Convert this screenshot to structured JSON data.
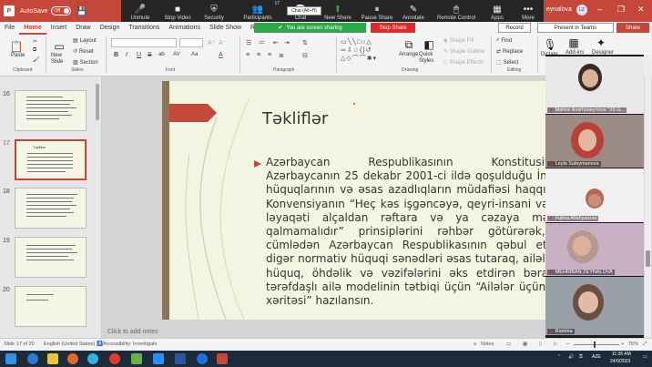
{
  "titlebar": {
    "autosave_label": "AutoSave",
    "autosave_state": "Off",
    "user_name": "eynalova",
    "user_initials": "LZ"
  },
  "zoom_toolbar": {
    "items": [
      {
        "label": "Unmute",
        "glyph": "🎤"
      },
      {
        "label": "Stop Video",
        "glyph": "■"
      },
      {
        "label": "Security",
        "glyph": "⛨"
      },
      {
        "label": "Participants",
        "glyph": "👥",
        "count": "17"
      },
      {
        "label": "Chat",
        "glyph": "💬"
      },
      {
        "label": "New Share",
        "glyph": "⬆"
      },
      {
        "label": "Pause Share",
        "glyph": "⏸"
      },
      {
        "label": "Annotate",
        "glyph": "✎"
      },
      {
        "label": "Remote Control",
        "glyph": "🖱"
      },
      {
        "label": "Apps",
        "glyph": "▦"
      },
      {
        "label": "More",
        "glyph": "•••"
      }
    ],
    "chat_tooltip": "Chat (Alt+H)"
  },
  "ribbon_tabs": [
    "File",
    "Home",
    "Insert",
    "Draw",
    "Design",
    "Transitions",
    "Animations",
    "Slide Show",
    "Record"
  ],
  "active_tab": "Home",
  "screen_sharing_banner": "You are screen sharing",
  "stop_share_label": "Stop Share",
  "record_button": "Record",
  "present_button": "Present in Teams",
  "share_button": "Share",
  "ribbon": {
    "clipboard": {
      "paste": "Paste",
      "label": "Clipboard"
    },
    "slides": {
      "new_slide": "New Slide",
      "layout": "Layout",
      "reset": "Reset",
      "section": "Section",
      "label": "Slides"
    },
    "font_label": "Font",
    "font_buttons": [
      "B",
      "I",
      "U",
      "S",
      "ab",
      "AV",
      "Aa",
      "A"
    ],
    "paragraph_label": "Paragraph",
    "drawing": {
      "arrange": "Arrange",
      "quick_styles": "Quick Styles",
      "shape_fill": "Shape Fill",
      "shape_outline": "Shape Outline",
      "shape_effects": "Shape Effects",
      "label": "Drawing"
    },
    "editing": {
      "find": "Find",
      "replace": "Replace",
      "select": "Select",
      "label": "Editing"
    },
    "voice": {
      "dictate": "Dictate",
      "label": "Voice"
    },
    "addins": {
      "addins": "Add-ins",
      "label": "Add-ins"
    },
    "designer": {
      "designer": "Designer"
    }
  },
  "thumbnails": [
    {
      "number": "16",
      "active": false
    },
    {
      "number": "17",
      "active": true,
      "title": "Təkliflər"
    },
    {
      "number": "18",
      "active": false
    },
    {
      "number": "19",
      "active": false
    },
    {
      "number": "20",
      "active": false
    }
  ],
  "slide": {
    "title": "Təkliflər",
    "body": "Azərbaycan Respublikasının Konstitusiyası Azərbaycanın 25 dekabr 2001-ci ildə qoşulduğu İnsan hüquqlarının və əsas azadlıqların müdafiəsi haqqında Konvensiyanın “Heç kəs işgəncəyə, qeyri-insani və ya ləyaqəti alçaldan rəftara və ya cəzaya məruz qalmamalıdır” prinsiplərini rəhbər götürərək, o cümlədən Azərbaycan Respublikasının qəbul etdiyi digər normativ hüquqi sənədləri əsas tutaraq, ailələrin hüquq, öhdəlik və vəzifələrini əks etdirən bərabər tərəfdaşlı ailə modelinin tətbiqi üçün “Ailələr üçün yol xəritəsi” hazılansın."
  },
  "notes_placeholder": "Click to add notes",
  "participants": [
    {
      "name": "Mahire Amirhuseynova \"XII G...",
      "muted": true
    },
    {
      "name": "Leyla Suleymanova",
      "muted": true
    },
    {
      "name": "Fatma Allahyarova",
      "muted": true
    },
    {
      "name": "MEHRIBAN ZEYNALOVA",
      "muted": true
    },
    {
      "name": "Ramina",
      "muted": true
    }
  ],
  "statusbar": {
    "slide_info": "Slide 17 of 20",
    "language": "English (United States)",
    "accessibility": "Accessibility: Investigate",
    "notes": "Notes",
    "zoom": "75%"
  },
  "taskbar": {
    "language": "AZE",
    "time": "11:35 AM",
    "date": "24/9/2023"
  },
  "colors": {
    "accent": "#c4473a",
    "share_green": "#29a848",
    "stop_red": "#e02828",
    "slide_bg": "#f3f5e2"
  }
}
